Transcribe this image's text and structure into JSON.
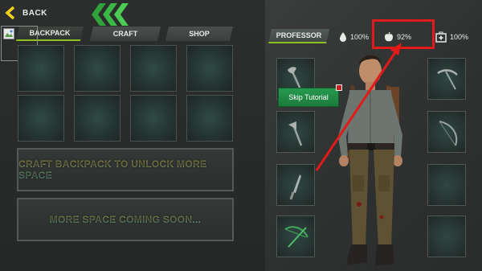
{
  "header": {
    "back_label": "BACK"
  },
  "tabs": [
    {
      "label": "BACKPACK",
      "active": true
    },
    {
      "label": "CRAFT",
      "active": false
    },
    {
      "label": "SHOP",
      "active": false
    }
  ],
  "inventory": {
    "empty_slots": 8,
    "craft_message": "CRAFT BACKPACK TO UNLOCK MORE SPACE",
    "coming_soon_message": "MORE SPACE COMING SOON..."
  },
  "character_panel": {
    "tab_label": "PROFESSOR",
    "stats": {
      "water": {
        "icon": "water-drop-icon",
        "value": "100%"
      },
      "food": {
        "icon": "apple-icon",
        "value": "92%"
      },
      "health": {
        "icon": "first-aid-kit-icon",
        "value": "100%"
      }
    },
    "left_equipment": [
      "axe-icon",
      "hatchet-icon",
      "knife-icon",
      "crossbow-icon"
    ],
    "right_equipment": [
      "pickaxe-icon",
      "bow-icon",
      "empty-slot",
      "empty-slot"
    ]
  },
  "tutorial": {
    "skip_label": "Skip Tutorial"
  },
  "colors": {
    "accent_green": "#8fbf1f",
    "back_yellow": "#f2d21b",
    "skip_green": "#1f8a44",
    "highlight_red": "#e11a1a",
    "message_gold": "#d7c25a",
    "message_teal": "#6fb6b0"
  }
}
